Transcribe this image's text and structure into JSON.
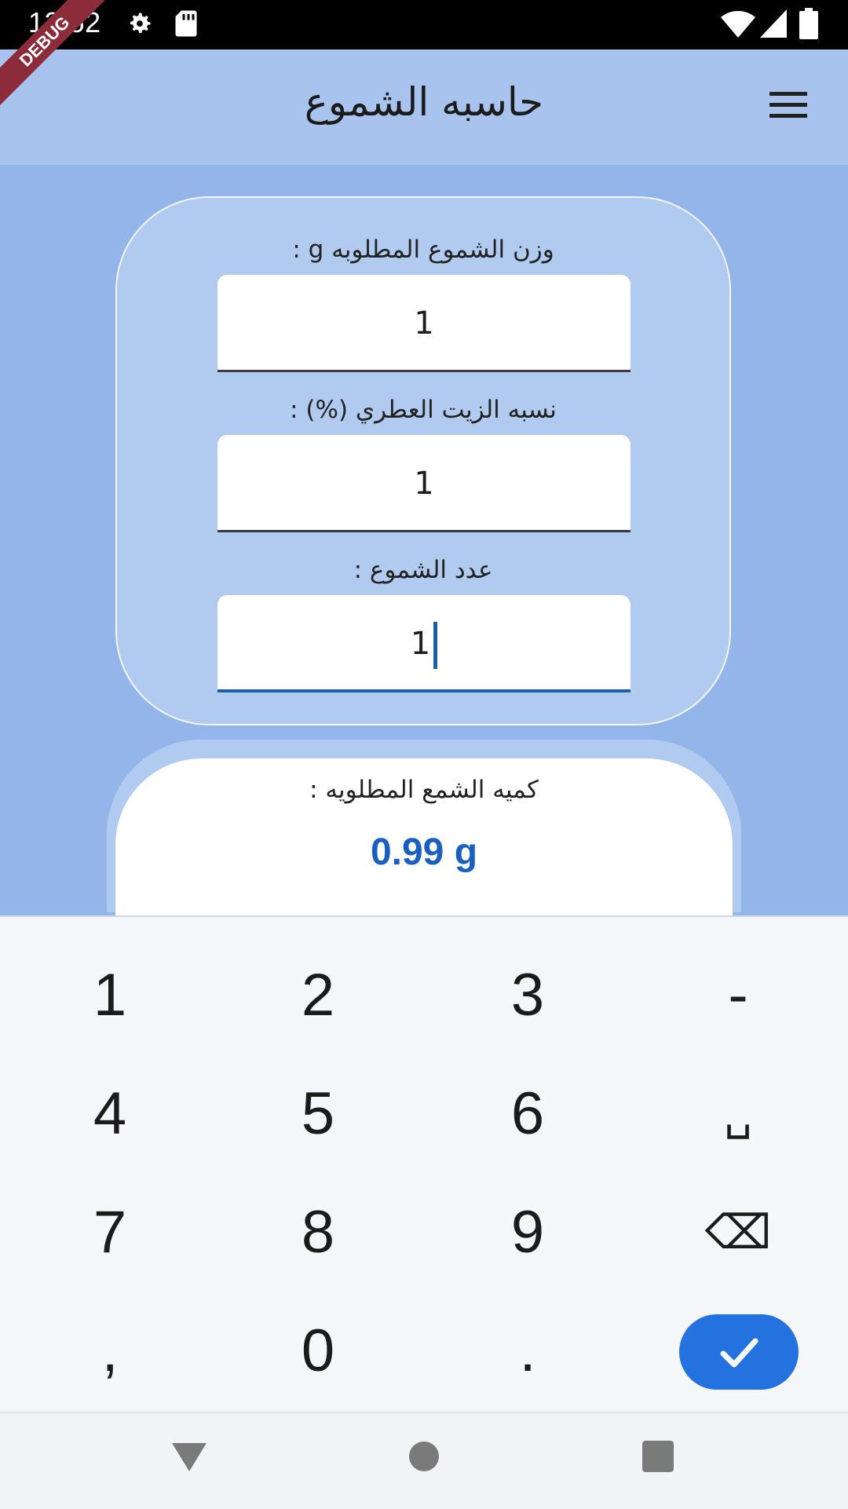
{
  "status_bar": {
    "time": "12:52"
  },
  "debug_banner": "DEBUG",
  "app_bar": {
    "title": "حاسبه الشموع"
  },
  "form": {
    "weight_label": "وزن الشموع المطلوبه g :",
    "weight_value": "1",
    "oil_label": "نسبه الزيت العطري (%) :",
    "oil_value": "1",
    "count_label": "عدد الشموع :",
    "count_value": "1"
  },
  "result": {
    "label": "كميه الشمع المطلويه :",
    "value": "0.99 g"
  },
  "keyboard": {
    "keys": [
      "1",
      "2",
      "3",
      "-",
      "4",
      "5",
      "6",
      "␣",
      "7",
      "8",
      "9",
      "⌫",
      ",",
      "0",
      "."
    ],
    "enter_icon": "check-icon"
  },
  "nav_bar": {
    "back_icon": "back-triangle-icon",
    "home_icon": "home-circle-icon",
    "recents_icon": "recents-square-icon"
  },
  "colors": {
    "accent": "#2471e0",
    "result": "#1a5fc0",
    "background": "#93b5e9"
  }
}
